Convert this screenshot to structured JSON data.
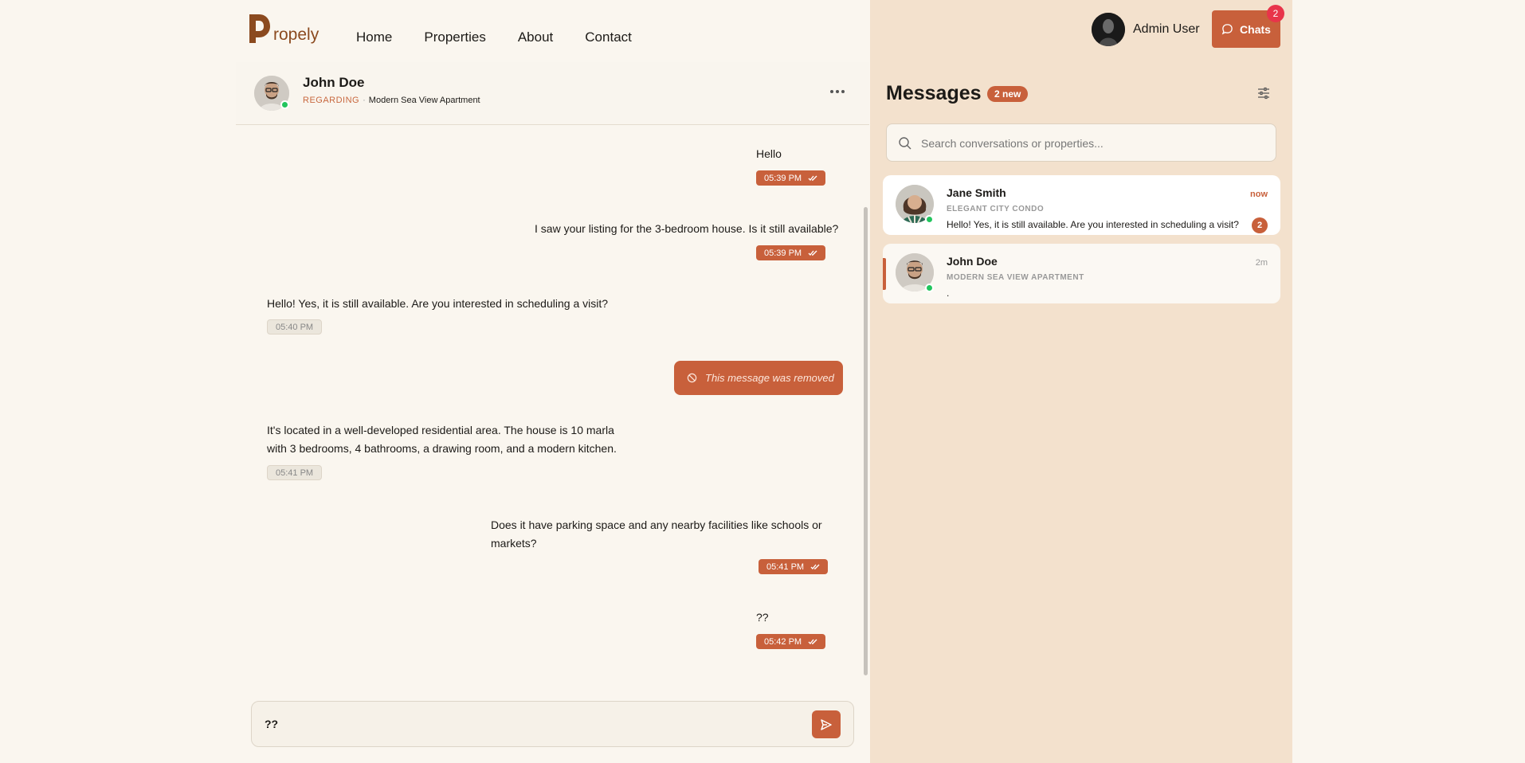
{
  "brand": {
    "name": "ropely",
    "accent": "#c8603b"
  },
  "nav": {
    "items": [
      "Home",
      "Properties",
      "About",
      "Contact"
    ]
  },
  "chat": {
    "contact_name": "John Doe",
    "regarding_label": "REGARDING",
    "property": "Modern Sea View Apartment",
    "messages": [
      {
        "text": "Hello",
        "time": "05:39 PM"
      },
      {
        "text": "I saw your listing for the 3-bedroom house. Is it still available?",
        "time": "05:39 PM"
      },
      {
        "text": "Hello! Yes, it is still available. Are you interested in scheduling a visit?",
        "time": "05:40 PM"
      },
      {
        "text": "This message was removed"
      },
      {
        "text": "It's located in a well-developed residential area. The house is 10 marla with 3 bedrooms, 4 bathrooms, a drawing room, and a modern kitchen.",
        "time": "05:41 PM"
      },
      {
        "text": "Does it have parking space and any nearby facilities like schools or markets?",
        "time": "05:41 PM"
      },
      {
        "text": "??",
        "time": "05:42 PM"
      }
    ],
    "composer_value": "??"
  },
  "sidebar": {
    "admin_name": "Admin User",
    "chats_label": "Chats",
    "chats_badge": "2",
    "title": "Messages",
    "new_badge": "2 new",
    "search_placeholder": "Search conversations or properties...",
    "conversations": [
      {
        "name": "Jane Smith",
        "property": "ELEGANT CITY CONDO",
        "preview": "Hello! Yes, it is still available. Are you interested in scheduling a visit?",
        "time": "now",
        "unread": "2"
      },
      {
        "name": "John Doe",
        "property": "MODERN SEA VIEW APARTMENT",
        "preview": ".",
        "time": "2m"
      }
    ]
  }
}
